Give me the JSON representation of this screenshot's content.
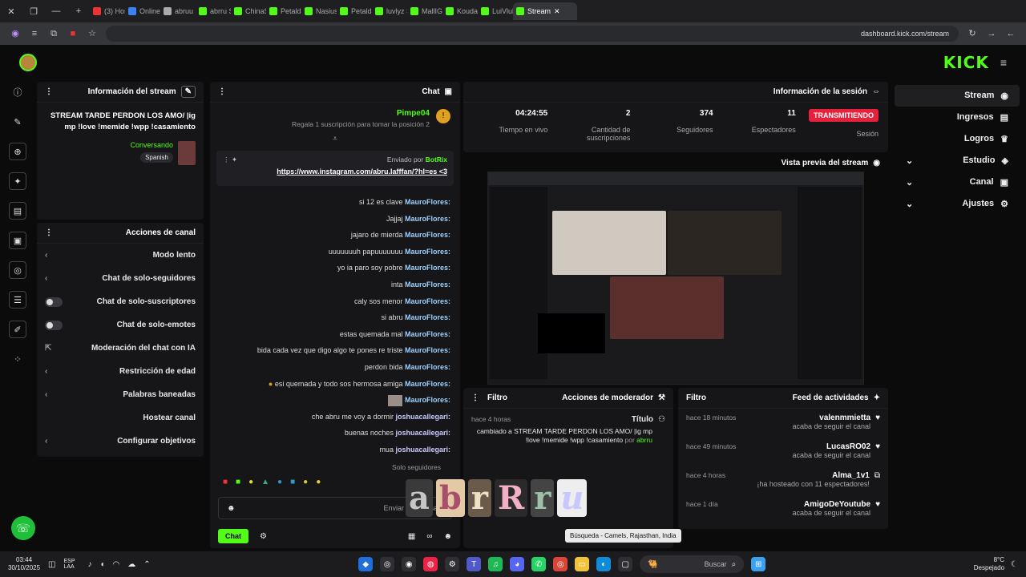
{
  "browser": {
    "tabs": [
      "(3) Hos",
      "Online-F",
      "abruu (o",
      "abrru Str",
      "ChinaS9",
      "Petalda S",
      "Nasius S",
      "Petalda S",
      "luvlyz St",
      "MallIGC",
      "Kouda35",
      "LuiVluk S",
      "Stream"
    ],
    "url": "dashboard.kick.com/stream"
  },
  "nav": {
    "items": [
      "Stream",
      "Ingresos",
      "Logros",
      "Estudio",
      "Canal",
      "Ajustes"
    ],
    "logo": "KICK"
  },
  "stream_info": {
    "title": "Información del stream",
    "text": "STREAM TARDE PERDON LOS AMO/ |ig mp !love !memide !wpp !casamiento",
    "category": "Conversando",
    "language": "Spanish"
  },
  "channel_actions": {
    "title": "Acciones de canal",
    "items": [
      "Modo lento",
      "Chat de solo-seguidores",
      "Chat de solo-suscriptores",
      "Chat de solo-emotes",
      "Moderación del chat con IA",
      "Restricción de edad",
      "Palabras baneadas",
      "Hostear canal",
      "Configurar objetivos"
    ]
  },
  "chat": {
    "title": "Chat",
    "gift_user": "Pimpe04",
    "gift_text": "Regala 1 suscripción para tomar la posición 2",
    "pinned_by_label": "Enviado por",
    "pinned_by": "BotRix",
    "pinned_link": "https://www.instagram.com/abru.lafffan/?hl=es <3",
    "messages": [
      {
        "u": "MauroFlores:",
        "t": "si 12 es clave"
      },
      {
        "u": "MauroFlores:",
        "t": "Jajjaj"
      },
      {
        "u": "MauroFlores:",
        "t": "jajaro de mierda"
      },
      {
        "u": "MauroFlores:",
        "t": "uuuuuuuh papuuuuuuu"
      },
      {
        "u": "MauroFlores:",
        "t": "yo ia paro soy pobre"
      },
      {
        "u": "MauroFlores:",
        "t": "inta"
      },
      {
        "u": "MauroFlores:",
        "t": "caly sos menor"
      },
      {
        "u": "MauroFlores:",
        "t": "si abru"
      },
      {
        "u": "MauroFlores:",
        "t": "estas quemada mal"
      },
      {
        "u": "MauroFlores:",
        "t": "bida cada vez que digo algo te pones re triste"
      },
      {
        "u": "MauroFlores:",
        "t": "perdon bida"
      },
      {
        "u": "MauroFlores:",
        "t": "esi quemada y todo sos hermosa amiga"
      },
      {
        "u": "MauroFlores:",
        "t": ""
      },
      {
        "u": "joshuacallegari:",
        "t": "che abru me voy a dormir"
      },
      {
        "u": "joshuacallegari:",
        "t": "buenas noches"
      },
      {
        "u": "joshuacallegari:",
        "t": "mua"
      }
    ],
    "followers_only": "Solo seguidores",
    "placeholder": "Enviar un mensaje",
    "send_label": "Chat"
  },
  "session": {
    "title": "Información de la sesión",
    "live_label": "TRANSMITIENDO",
    "session_label": "Sesión",
    "viewers": "11",
    "viewers_label": "Espectadores",
    "followers": "374",
    "followers_label": "Seguidores",
    "subs": "2",
    "subs_label": "Cantidad de suscripciones",
    "time": "04:24:55",
    "time_label": "Tiempo en vivo"
  },
  "preview": {
    "title": "Vista previa del stream"
  },
  "mod_actions": {
    "title": "Acciones de moderador",
    "filter": "Filtro",
    "item_title": "Título",
    "item_time": "hace 4 horas",
    "item_text": "cambiado a STREAM TARDE PERDON LOS AMO/ |ig mp !love !memide !wpp !casamiento",
    "item_by": "por",
    "item_user": "abrru"
  },
  "activity": {
    "title": "Feed de actividades",
    "filter": "Filtro",
    "items": [
      {
        "name": "valenmmietta",
        "act": "acaba de seguir el canal",
        "time": "hace 18 minutos"
      },
      {
        "name": "LucasRO02",
        "act": "acaba de seguir el canal",
        "time": "hace 49 minutos"
      },
      {
        "name": "Alma_1v1",
        "act": "¡ha hosteado con 11 espectadores!",
        "time": "hace 4 horas"
      },
      {
        "name": "AmigoDeYoutube",
        "act": "acaba de seguir el canal",
        "time": "hace 1 día"
      }
    ]
  },
  "overlay": {
    "sticker_letters": [
      "a",
      "b",
      "r",
      "R",
      "r",
      "u"
    ],
    "tooltip": "Búsqueda - Camels, Rajasthan, India"
  },
  "taskbar": {
    "weather_temp": "8°C",
    "weather_text": "Despejado",
    "search": "Buscar",
    "time": "03:44",
    "date": "30/10/2025",
    "lang": "ESP LAA"
  },
  "colors": {
    "accent": "#53fc18",
    "live": "#e8203c"
  }
}
